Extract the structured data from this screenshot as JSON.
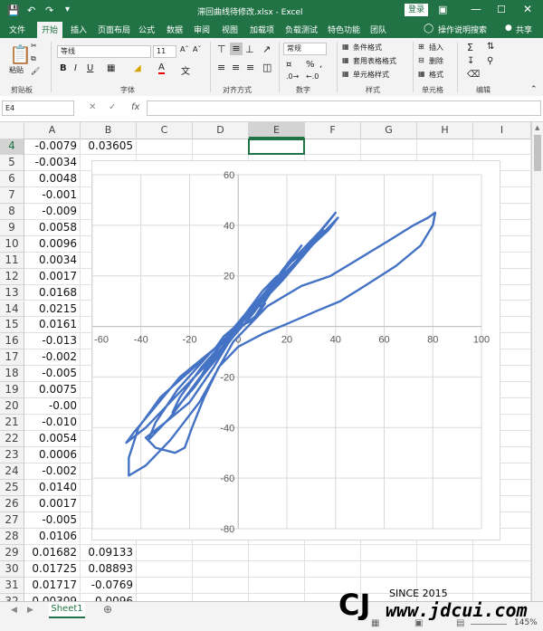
{
  "title_bar": {
    "title": "滞回曲线待修改.xlsx  -  Excel",
    "login_label": "登录"
  },
  "tabs": [
    "文件",
    "开始",
    "插入",
    "页面布局",
    "公式",
    "数据",
    "审阅",
    "视图",
    "加载项",
    "负载测试",
    "特色功能",
    "团队"
  ],
  "active_tab": "开始",
  "tell_me": "操作说明搜索",
  "share_label": "共享",
  "ribbon": {
    "paste_label": "粘贴",
    "font_name": "等线",
    "font_size": "11",
    "number_format": "常规",
    "cond_format": "条件格式",
    "table_format": "套用表格格式",
    "cell_style": "单元格样式",
    "insert": "插入",
    "delete": "删除",
    "format": "格式",
    "groups": [
      "剪贴板",
      "字体",
      "对齐方式",
      "数字",
      "样式",
      "单元格",
      "编辑"
    ]
  },
  "formula_bar": {
    "name_box": "E4",
    "fx": "fx",
    "formula": ""
  },
  "columns": [
    "A",
    "B",
    "C",
    "D",
    "E",
    "F",
    "G",
    "H",
    "I"
  ],
  "selected_column": "E",
  "rows": [
    {
      "n": "4",
      "a": "-0.0079",
      "b": "0.03605"
    },
    {
      "n": "5",
      "a": "-0.0034",
      "b": ""
    },
    {
      "n": "6",
      "a": "0.0048",
      "b": ""
    },
    {
      "n": "7",
      "a": "-0.001",
      "b": ""
    },
    {
      "n": "8",
      "a": "-0.009",
      "b": ""
    },
    {
      "n": "9",
      "a": "0.0058",
      "b": ""
    },
    {
      "n": "10",
      "a": "0.0096",
      "b": ""
    },
    {
      "n": "11",
      "a": "0.0034",
      "b": ""
    },
    {
      "n": "12",
      "a": "0.0017",
      "b": ""
    },
    {
      "n": "13",
      "a": "0.0168",
      "b": ""
    },
    {
      "n": "14",
      "a": "0.0215",
      "b": ""
    },
    {
      "n": "15",
      "a": "0.0161",
      "b": ""
    },
    {
      "n": "16",
      "a": "-0.013",
      "b": ""
    },
    {
      "n": "17",
      "a": "-0.002",
      "b": ""
    },
    {
      "n": "18",
      "a": "-0.005",
      "b": ""
    },
    {
      "n": "19",
      "a": "0.0075",
      "b": ""
    },
    {
      "n": "20",
      "a": "-0.00",
      "b": ""
    },
    {
      "n": "21",
      "a": "-0.010",
      "b": ""
    },
    {
      "n": "22",
      "a": "0.0054",
      "b": ""
    },
    {
      "n": "23",
      "a": "0.0006",
      "b": ""
    },
    {
      "n": "24",
      "a": "-0.002",
      "b": ""
    },
    {
      "n": "25",
      "a": "0.0140",
      "b": ""
    },
    {
      "n": "26",
      "a": "0.0017",
      "b": ""
    },
    {
      "n": "27",
      "a": "-0.005",
      "b": ""
    },
    {
      "n": "28",
      "a": "0.0106",
      "b": ""
    },
    {
      "n": "29",
      "a": "0.01682",
      "b": "0.09133"
    },
    {
      "n": "30",
      "a": "0.01725",
      "b": "0.08893"
    },
    {
      "n": "31",
      "a": "0.01717",
      "b": "-0.0769"
    },
    {
      "n": "32",
      "a": "0.00309",
      "b": "-0.0096"
    }
  ],
  "sheet_tab": "Sheet1",
  "zoom": "145%",
  "watermark": "SINCE 2015 www.jdcui.com",
  "chart_data": {
    "type": "scatter",
    "title": "",
    "xlabel": "",
    "ylabel": "",
    "xlim": [
      -60,
      100
    ],
    "ylim": [
      -80,
      60
    ],
    "xticks": [
      -60,
      -40,
      -20,
      0,
      20,
      40,
      60,
      80,
      100
    ],
    "yticks": [
      -80,
      -60,
      -40,
      -20,
      0,
      20,
      40,
      60
    ],
    "color": "#4472c4",
    "series": [
      {
        "values_xy": [
          [
            0,
            0
          ],
          [
            5,
            2
          ],
          [
            9,
            6
          ],
          [
            11,
            9
          ],
          [
            6,
            7
          ],
          [
            0,
            1
          ],
          [
            -6,
            -4
          ],
          [
            -9,
            -8
          ],
          [
            -6,
            -6
          ],
          [
            0,
            -1
          ],
          [
            7,
            4
          ],
          [
            13,
            13
          ],
          [
            16,
            20
          ],
          [
            10,
            14
          ],
          [
            3,
            5
          ],
          [
            -4,
            -3
          ],
          [
            -12,
            -14
          ],
          [
            -16,
            -21
          ],
          [
            -10,
            -14
          ],
          [
            -2,
            -4
          ],
          [
            6,
            5
          ],
          [
            16,
            18
          ],
          [
            23,
            28
          ],
          [
            26,
            32
          ],
          [
            18,
            22
          ],
          [
            8,
            8
          ],
          [
            -4,
            -4
          ],
          [
            -15,
            -16
          ],
          [
            -24,
            -28
          ],
          [
            -27,
            -34
          ],
          [
            -18,
            -24
          ],
          [
            -6,
            -8
          ],
          [
            8,
            10
          ],
          [
            20,
            24
          ],
          [
            31,
            33
          ],
          [
            35,
            38
          ],
          [
            28,
            30
          ],
          [
            15,
            15
          ],
          [
            2,
            2
          ],
          [
            -12,
            -11
          ],
          [
            -25,
            -25
          ],
          [
            -34,
            -38
          ],
          [
            -37,
            -45
          ],
          [
            -28,
            -36
          ],
          [
            -14,
            -18
          ],
          [
            0,
            0
          ],
          [
            14,
            16
          ],
          [
            28,
            30
          ],
          [
            37,
            38
          ],
          [
            41,
            43
          ],
          [
            33,
            35
          ],
          [
            18,
            18
          ],
          [
            4,
            4
          ],
          [
            -10,
            -9
          ],
          [
            -24,
            -20
          ],
          [
            -36,
            -34
          ],
          [
            -43,
            -42
          ],
          [
            -46,
            -46
          ],
          [
            -38,
            -40
          ],
          [
            -24,
            -26
          ],
          [
            -8,
            -10
          ],
          [
            8,
            10
          ],
          [
            24,
            28
          ],
          [
            36,
            40
          ],
          [
            40,
            45
          ],
          [
            40,
            45
          ],
          [
            34,
            38
          ],
          [
            20,
            21
          ],
          [
            8,
            9
          ],
          [
            -4,
            -4
          ],
          [
            -18,
            -16
          ],
          [
            -32,
            -28
          ],
          [
            -41,
            -40
          ],
          [
            -45,
            -52
          ],
          [
            -45,
            -59
          ],
          [
            -38,
            -55
          ],
          [
            -28,
            -45
          ],
          [
            -16,
            -30
          ],
          [
            -2,
            -6
          ],
          [
            12,
            8
          ],
          [
            26,
            16
          ],
          [
            38,
            20
          ],
          [
            50,
            27
          ],
          [
            62,
            34
          ],
          [
            72,
            40
          ],
          [
            78,
            43
          ],
          [
            81,
            45
          ],
          [
            80,
            40
          ],
          [
            75,
            32
          ],
          [
            65,
            24
          ],
          [
            52,
            16
          ],
          [
            42,
            10
          ],
          [
            32,
            6
          ],
          [
            20,
            1
          ],
          [
            10,
            -3
          ],
          [
            0,
            -8
          ],
          [
            -8,
            -16
          ],
          [
            -14,
            -28
          ],
          [
            -19,
            -40
          ],
          [
            -22,
            -48
          ],
          [
            -26,
            -50
          ],
          [
            -34,
            -48
          ],
          [
            -38,
            -44
          ],
          [
            -30,
            -38
          ],
          [
            -20,
            -30
          ],
          [
            -10,
            -16
          ],
          [
            0,
            0
          ]
        ]
      }
    ]
  }
}
